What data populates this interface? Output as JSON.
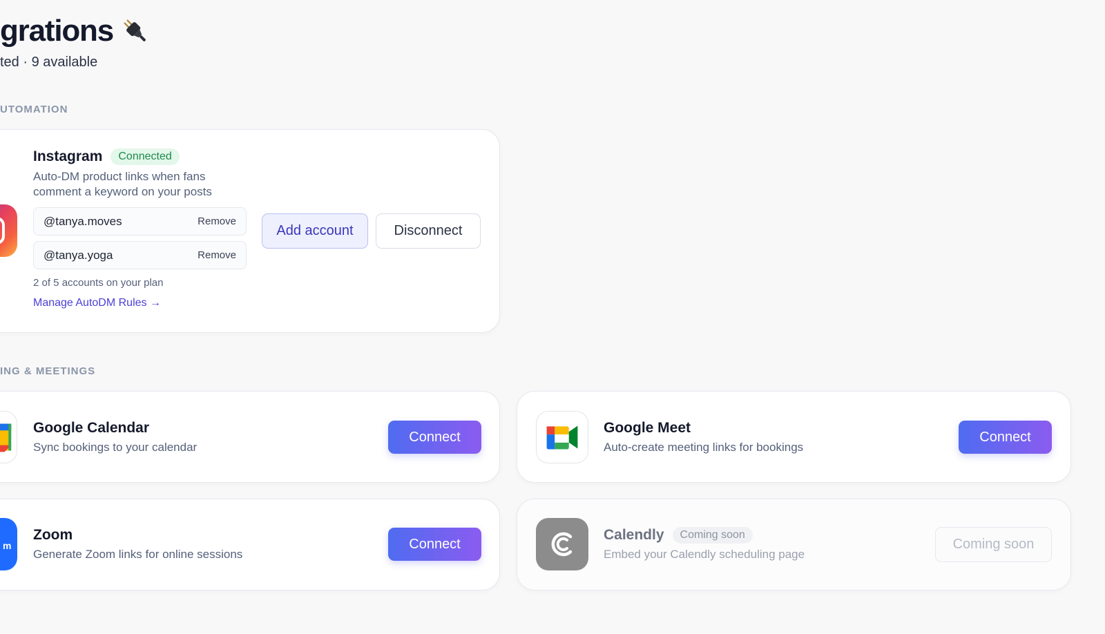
{
  "header": {
    "title": "grations",
    "subtitle": "ted · 9 available",
    "plug_icon": "electric-plug-icon"
  },
  "sections": {
    "automation": "UTOMATION",
    "scheduling": "ING & MEETINGS"
  },
  "instagram": {
    "name": "Instagram",
    "badge": "Connected",
    "desc_line1": "Auto-DM product links when fans",
    "desc_line2": "comment a keyword on your posts",
    "accounts": [
      {
        "handle": "@tanya.moves",
        "remove": "Remove"
      },
      {
        "handle": "@tanya.yoga",
        "remove": "Remove"
      }
    ],
    "plan_note": "2 of 5 accounts on your plan",
    "manage_link": "Manage AutoDM Rules →",
    "add_account": "Add account",
    "disconnect": "Disconnect"
  },
  "google_calendar": {
    "name": "Google Calendar",
    "desc": "Sync bookings to your calendar",
    "action": "Connect"
  },
  "google_meet": {
    "name": "Google Meet",
    "desc": "Auto-create meeting links for bookings",
    "action": "Connect"
  },
  "zoom": {
    "name": "Zoom",
    "desc": "Generate Zoom links for online sessions",
    "action": "Connect"
  },
  "calendly": {
    "name": "Calendly",
    "badge": "Coming soon",
    "desc": "Embed your Calendly scheduling page",
    "action": "Coming soon"
  },
  "colors": {
    "accent_start": "#4f6cf0",
    "accent_end": "#8b5cf0",
    "connected_green": "#1f8a4c",
    "link_purple": "#4b3fd6"
  }
}
